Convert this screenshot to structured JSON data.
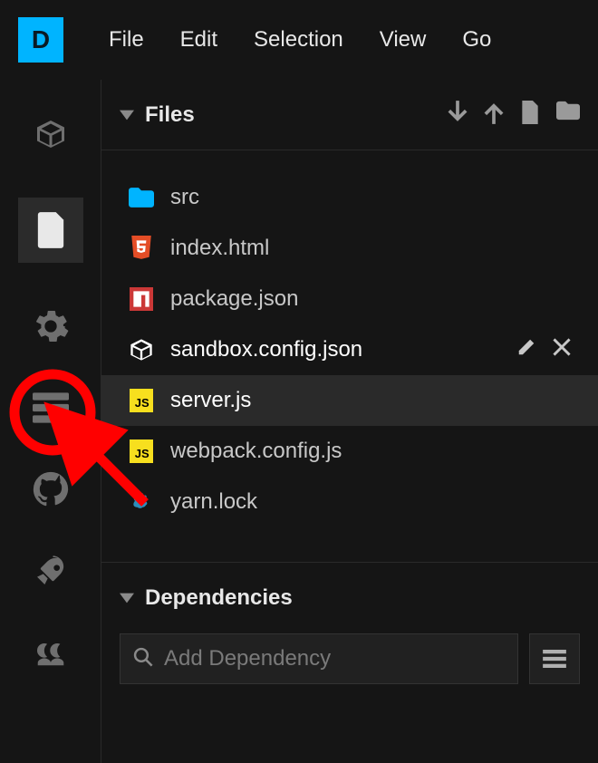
{
  "logo_letter": "D",
  "menu": [
    "File",
    "Edit",
    "Selection",
    "View",
    "Go"
  ],
  "activity": [
    {
      "name": "sandbox-icon"
    },
    {
      "name": "files-icon",
      "selected": true
    },
    {
      "name": "settings-icon"
    },
    {
      "name": "server-icon"
    },
    {
      "name": "github-icon"
    },
    {
      "name": "deploy-icon"
    },
    {
      "name": "live-icon"
    }
  ],
  "files_section": {
    "title": "Files",
    "actions": [
      "download-icon",
      "upload-icon",
      "new-file-icon",
      "new-folder-icon"
    ]
  },
  "files": [
    {
      "name": "src",
      "icon": "folder-icon",
      "color": "#00b4ff",
      "type": "folder"
    },
    {
      "name": "index.html",
      "icon": "html-icon",
      "color": "#e44d26"
    },
    {
      "name": "package.json",
      "icon": "npm-icon",
      "color": "#cb3837"
    },
    {
      "name": "sandbox.config.json",
      "icon": "codesandbox-icon",
      "color": "#ffffff",
      "hovered": true
    },
    {
      "name": "server.js",
      "icon": "js-icon",
      "color": "#f7df1e",
      "selected": true
    },
    {
      "name": "webpack.config.js",
      "icon": "js-icon",
      "color": "#f7df1e"
    },
    {
      "name": "yarn.lock",
      "icon": "yarn-icon",
      "color": "#2c8ebb"
    }
  ],
  "deps_section": {
    "title": "Dependencies",
    "search_placeholder": "Add Dependency"
  }
}
